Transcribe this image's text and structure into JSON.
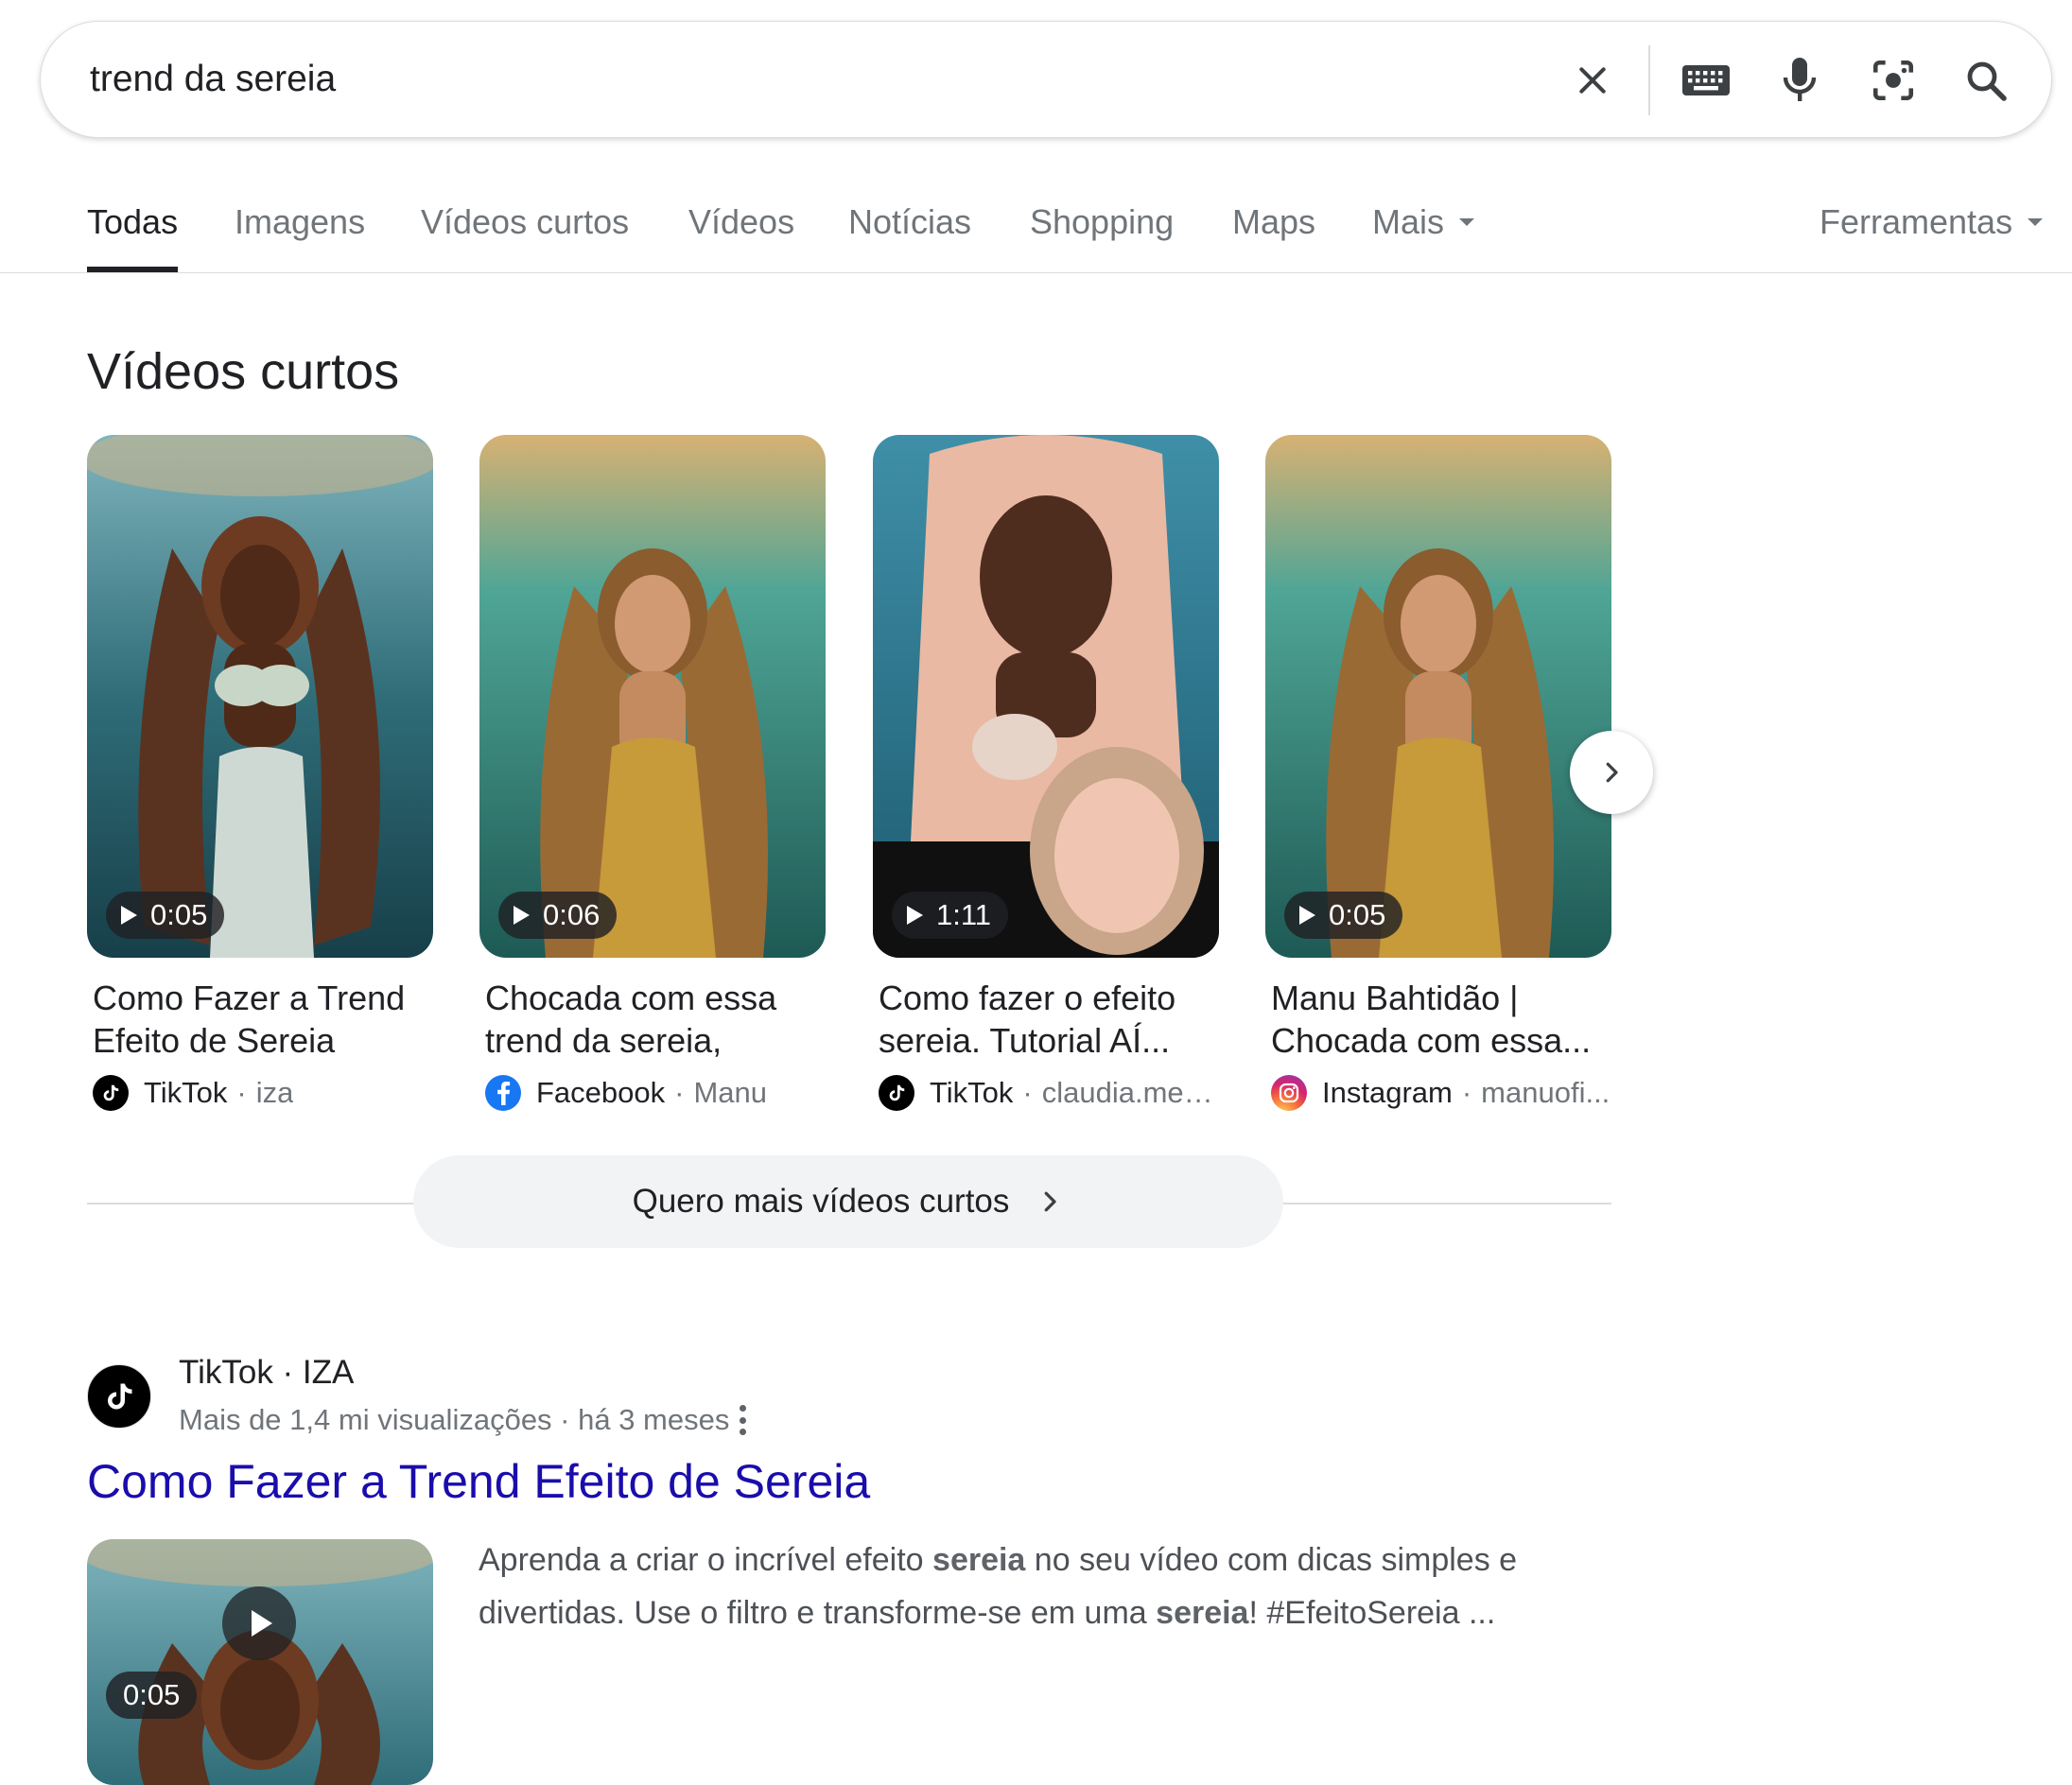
{
  "search": {
    "query": "trend da sereia",
    "icons": [
      "close-icon",
      "keyboard-icon",
      "microphone-icon",
      "lens-icon",
      "search-icon"
    ]
  },
  "tabs": [
    {
      "label": "Todas",
      "active": true
    },
    {
      "label": "Imagens"
    },
    {
      "label": "Vídeos curtos"
    },
    {
      "label": "Vídeos"
    },
    {
      "label": "Notícias"
    },
    {
      "label": "Shopping"
    },
    {
      "label": "Maps"
    },
    {
      "label": "Mais"
    }
  ],
  "tools_label": "Ferramentas",
  "short_videos": {
    "title": "Vídeos curtos",
    "cards": [
      {
        "duration": "0:05",
        "title": "Como Fazer a Trend Efeito de Sereia",
        "platform": "TikTok",
        "author": "iza",
        "platform_icon": "tiktok-icon"
      },
      {
        "duration": "0:06",
        "title": "Chocada com essa trend da sereia, amei...",
        "platform": "Facebook",
        "author": "Manu",
        "platform_icon": "facebook-icon"
      },
      {
        "duration": "1:11",
        "title": "Como fazer o efeito sereia. Tutorial AÍ...",
        "platform": "TikTok",
        "author": "claudia.mechi",
        "platform_icon": "tiktok-icon"
      },
      {
        "duration": "0:05",
        "title": "Manu Bahtidão | Chocada com essa...",
        "platform": "Instagram",
        "author": "manuofi...",
        "platform_icon": "instagram-icon"
      }
    ],
    "more_label": "Quero mais vídeos curtos"
  },
  "result": {
    "source": "TikTok · IZA",
    "meta": "Mais de 1,4 mi visualizações · há 3 meses",
    "title": "Como Fazer a Trend Efeito de Sereia",
    "duration": "0:05",
    "snippet_1": "Aprenda a criar o incrível efeito ",
    "snippet_b1": "sereia",
    "snippet_2": " no seu vídeo com dicas simples e divertidas. Use o filtro e transforme-se em uma ",
    "snippet_b2": "sereia",
    "snippet_3": "! #EfeitoSereia ..."
  },
  "colors": {
    "link": "#1a0dab",
    "text": "#202124",
    "muted": "#70757a",
    "border": "#dadce0",
    "chip_bg": "#f1f3f4"
  }
}
